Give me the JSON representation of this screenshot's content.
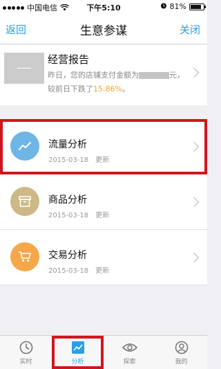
{
  "status_bar": {
    "carrier": "中国电信",
    "time": "下午5:10",
    "battery": "81%",
    "battery_level": 0.81
  },
  "nav": {
    "back": "返回",
    "title": "生意参谋",
    "close": "关闭"
  },
  "report": {
    "title": "经营报告",
    "desc_before": "昨日，您的店铺支付金额为",
    "desc_after": "元，较前日下跌了",
    "percent": "15.86%",
    "desc_end": "。"
  },
  "items": [
    {
      "label": "流量分析",
      "date": "2015-03-18",
      "status": "更新",
      "icon": "trend-icon",
      "color": "#6db6e6"
    },
    {
      "label": "商品分析",
      "date": "2015-03-18",
      "status": "更新",
      "icon": "box-icon",
      "color": "#cdb887"
    },
    {
      "label": "交易分析",
      "date": "2015-03-18",
      "status": "更新",
      "icon": "cart-icon",
      "color": "#f5a84a"
    }
  ],
  "tabs": [
    {
      "label": "实时",
      "icon": "clock-icon"
    },
    {
      "label": "分析",
      "icon": "chart-icon"
    },
    {
      "label": "探索",
      "icon": "eye-icon"
    },
    {
      "label": "我的",
      "icon": "user-icon"
    }
  ],
  "colors": {
    "accent": "#2a9ee8",
    "highlight": "#d0151c",
    "warning": "#f5a623"
  }
}
